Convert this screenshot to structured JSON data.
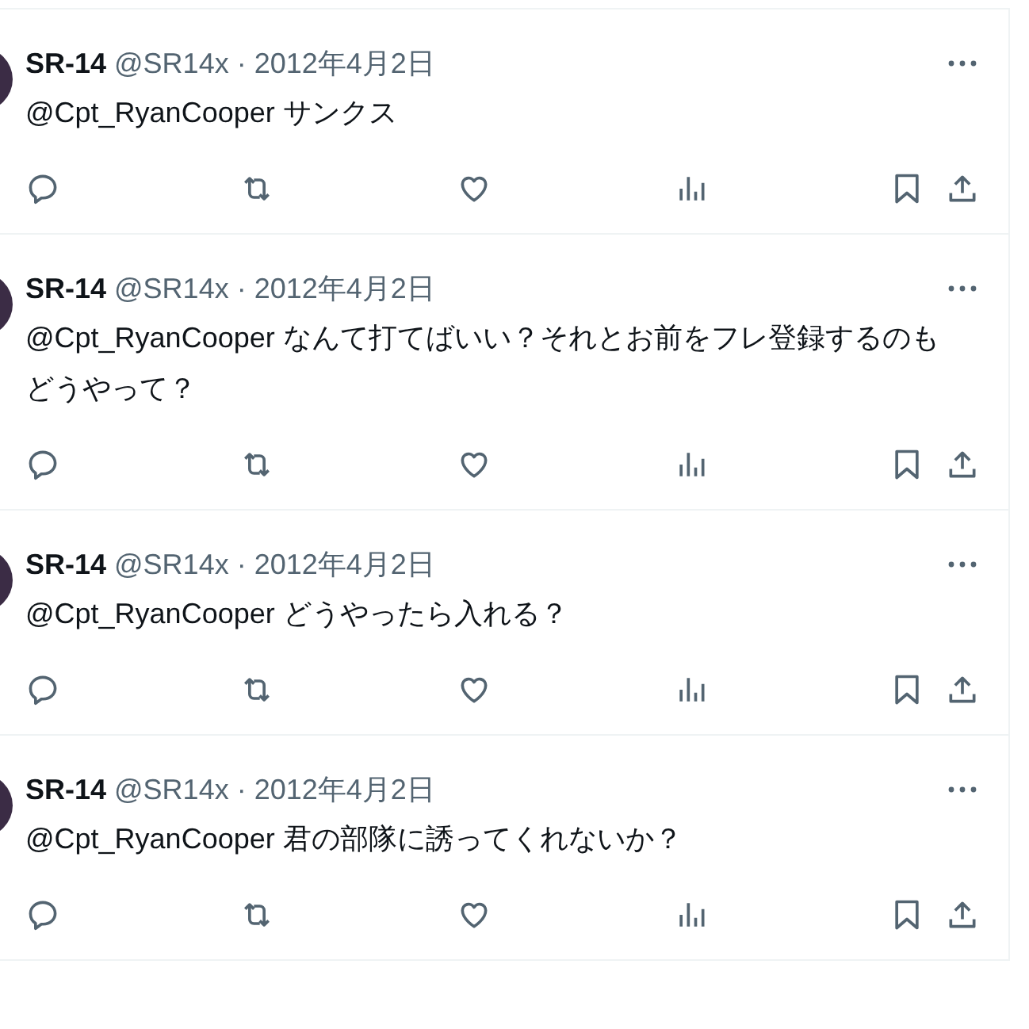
{
  "tweets": [
    {
      "name": "SR-14",
      "handle": "@SR14x",
      "dot": "·",
      "date": "2012年4月2日",
      "text": "@Cpt_RyanCooper サンクス"
    },
    {
      "name": "SR-14",
      "handle": "@SR14x",
      "dot": "·",
      "date": "2012年4月2日",
      "text": "@Cpt_RyanCooper なんて打てばいい？それとお前をフレ登録するのもどうやって？"
    },
    {
      "name": "SR-14",
      "handle": "@SR14x",
      "dot": "·",
      "date": "2012年4月2日",
      "text": "@Cpt_RyanCooper どうやったら入れる？"
    },
    {
      "name": "SR-14",
      "handle": "@SR14x",
      "dot": "·",
      "date": "2012年4月2日",
      "text": "@Cpt_RyanCooper 君の部隊に誘ってくれないか？"
    }
  ]
}
